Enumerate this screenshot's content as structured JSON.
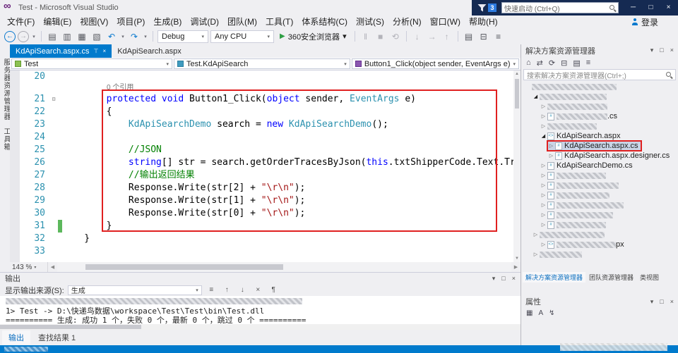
{
  "colors": {
    "accent": "#007ACC",
    "annotation_red": "#E02020",
    "keyword": "#0000FF",
    "type": "#2B91AF",
    "comment": "#008000",
    "string": "#A31515",
    "line_number": "#2B91AF",
    "title_overlay_bg": "#152A52"
  },
  "icons": {
    "vs_logo": "∞",
    "minimize": "─",
    "maximize": "□",
    "close": "×",
    "caret": "▾",
    "back": "←",
    "forward": "→",
    "new_file": "▤",
    "open_file": "▥",
    "save": "▦",
    "save_all": "▧",
    "undo": "↶",
    "redo": "↷",
    "play": "▶",
    "pause": "‖",
    "stop": "■",
    "restart": "⟲",
    "step_into": "↓",
    "step_over": "→",
    "step_out": "↑",
    "find": "▤",
    "pin": "⊤",
    "home": "⌂",
    "refresh": "⟳",
    "collapse_all": "⊟",
    "show_all_files": "▤",
    "properties": "≡",
    "sync": "⇄",
    "tree_collapsed": "▷",
    "tree_expanded": "◢",
    "fold_collapse": "⊟",
    "file_cs": "#",
    "file_aspx": "<>",
    "categorized": "▦",
    "alphabetical": "A",
    "events": "↯",
    "scroll_up": "▲",
    "scroll_down": "▼",
    "scroll_left": "◀",
    "scroll_right": "▶",
    "messages": "≡",
    "prev_message": "↑",
    "next_message": "↓",
    "clear_all": "×",
    "word_wrap": "¶"
  },
  "titlebar": {
    "title": "Test - Microsoft Visual Studio",
    "quick_launch": "快速启动 (Ctrl+Q)",
    "badge": "3"
  },
  "menubar": {
    "items": [
      "文件(F)",
      "编辑(E)",
      "视图(V)",
      "项目(P)",
      "生成(B)",
      "调试(D)",
      "团队(M)",
      "工具(T)",
      "体系结构(C)",
      "测试(S)",
      "分析(N)",
      "窗口(W)",
      "帮助(H)"
    ],
    "sign_in": "登录"
  },
  "toolbar": {
    "configuration": "Debug",
    "platform": "Any CPU",
    "run_target": "360安全浏览器"
  },
  "side_strip": {
    "tabs": [
      "服务器资源管理器",
      "工具箱"
    ]
  },
  "editor": {
    "tabs": [
      {
        "label": "KdApiSearch.aspx.cs",
        "active": true
      },
      {
        "label": "KdApiSearch.aspx",
        "active": false
      }
    ],
    "navbar": {
      "project": "Test",
      "type": "Test.KdApiSearch",
      "member": "Button1_Click(object sender, EventArgs e)"
    },
    "zoom": "143 %",
    "lines": [
      {
        "n": "20",
        "segs": []
      },
      {
        "n": "",
        "lens": true,
        "segs": [
          [
            "l",
            "0 个引用"
          ]
        ]
      },
      {
        "n": "21",
        "fold": true,
        "segs": [
          [
            "p",
            "        "
          ],
          [
            "k",
            "protected"
          ],
          [
            "p",
            " "
          ],
          [
            "k",
            "void"
          ],
          [
            "p",
            " Button1_Click("
          ],
          [
            "k",
            "object"
          ],
          [
            "p",
            " sender, "
          ],
          [
            "t",
            "EventArgs"
          ],
          [
            "p",
            " e)"
          ]
        ]
      },
      {
        "n": "22",
        "segs": [
          [
            "p",
            "        {"
          ]
        ]
      },
      {
        "n": "23",
        "segs": [
          [
            "p",
            "            "
          ],
          [
            "t",
            "KdApiSearchDemo"
          ],
          [
            "p",
            " search = "
          ],
          [
            "k",
            "new"
          ],
          [
            "p",
            " "
          ],
          [
            "t",
            "KdApiSearchDemo"
          ],
          [
            "p",
            "();"
          ]
        ]
      },
      {
        "n": "24",
        "segs": []
      },
      {
        "n": "25",
        "segs": [
          [
            "p",
            "            "
          ],
          [
            "c",
            "//JSON"
          ]
        ]
      },
      {
        "n": "26",
        "segs": [
          [
            "p",
            "            "
          ],
          [
            "k",
            "string"
          ],
          [
            "p",
            "[] str = search.getOrderTracesByJson("
          ],
          [
            "k",
            "this"
          ],
          [
            "p",
            ".txtShipperCode.Text.Trim(), t"
          ]
        ]
      },
      {
        "n": "27",
        "segs": [
          [
            "p",
            "            "
          ],
          [
            "c",
            "//输出返回结果"
          ]
        ]
      },
      {
        "n": "28",
        "segs": [
          [
            "p",
            "            Response.Write(str[2] + "
          ],
          [
            "s",
            "\"\\r\\n\""
          ],
          [
            "p",
            ");"
          ]
        ]
      },
      {
        "n": "29",
        "segs": [
          [
            "p",
            "            Response.Write(str[1] + "
          ],
          [
            "s",
            "\"\\r\\n\""
          ],
          [
            "p",
            ");"
          ]
        ]
      },
      {
        "n": "30",
        "segs": [
          [
            "p",
            "            Response.Write(str[0] + "
          ],
          [
            "s",
            "\"\\r\\n\""
          ],
          [
            "p",
            ");"
          ]
        ]
      },
      {
        "n": "31",
        "green": true,
        "segs": [
          [
            "p",
            "        }"
          ]
        ]
      },
      {
        "n": "32",
        "segs": [
          [
            "p",
            "    }"
          ]
        ]
      },
      {
        "n": "33",
        "segs": []
      }
    ]
  },
  "output": {
    "title": "输出",
    "source_label": "显示输出来源(S):",
    "source_value": "生成",
    "lines": [
      {
        "parts": [
          {
            "cw": 420
          }
        ]
      },
      {
        "parts": [
          {
            "t": "1>  Test -> D:\\快递鸟数据\\workspace\\Test\\Test\\bin\\Test.dll"
          }
        ]
      },
      {
        "parts": [
          {
            "t": "========== 生成: 成功 1 个，失败 0 个，最新 0 个，跳过 0 个 =========="
          }
        ]
      }
    ]
  },
  "bottom_tabs": [
    {
      "label": "输出",
      "active": true
    },
    {
      "label": "查找结果 1",
      "active": false
    }
  ],
  "solution_explorer": {
    "title": "解决方案资源管理器",
    "search_placeholder": "搜索解决方案资源管理器(Ctrl+;)",
    "items": [
      {
        "cw": 120,
        "indent": 0
      },
      {
        "cw": 95,
        "indent": 1,
        "arrow": "expanded"
      },
      {
        "cw": 85,
        "indent": 2,
        "arrow": "collapsed"
      },
      {
        "cw": 72,
        "indent": 2,
        "arrow": "collapsed",
        "suffix": ".cs",
        "icon": "cs"
      },
      {
        "cw": 70,
        "indent": 2,
        "arrow": "collapsed"
      },
      {
        "label": "KdApiSearch.aspx",
        "indent": 2,
        "arrow": "expanded",
        "icon": "aspx"
      },
      {
        "label": "KdApiSearch.aspx.cs",
        "indent": 3,
        "arrow": "collapsed",
        "icon": "cs",
        "selected": true,
        "annotated": true
      },
      {
        "label": "KdApiSearch.aspx.designer.cs",
        "indent": 3,
        "arrow": "collapsed",
        "icon": "cs"
      },
      {
        "label": "KdApiSearchDemo.cs",
        "indent": 2,
        "arrow": "collapsed",
        "icon": "cs"
      },
      {
        "cw": 70,
        "indent": 2,
        "arrow": "collapsed",
        "icon": "cs"
      },
      {
        "cw": 88,
        "indent": 2,
        "arrow": "collapsed",
        "icon": "cs"
      },
      {
        "cw": 75,
        "indent": 2,
        "arrow": "collapsed",
        "icon": "cs"
      },
      {
        "cw": 95,
        "indent": 2,
        "arrow": "collapsed",
        "icon": "cs"
      },
      {
        "cw": 80,
        "indent": 2,
        "arrow": "collapsed",
        "icon": "cs"
      },
      {
        "cw": 70,
        "indent": 2,
        "arrow": "collapsed",
        "icon": "cs"
      },
      {
        "cw": 92,
        "indent": 1,
        "arrow": "collapsed"
      },
      {
        "cw": 84,
        "indent": 2,
        "arrow": "collapsed",
        "suffix": "px",
        "icon": "aspx"
      },
      {
        "cw": 60,
        "indent": 1,
        "arrow": "collapsed"
      }
    ],
    "bottom_tabs": [
      {
        "label": "解决方案资源管理器",
        "active": true
      },
      {
        "label": "团队资源管理器",
        "active": false
      },
      {
        "label": "类视图",
        "active": false
      }
    ]
  },
  "properties_panel": {
    "title": "属性"
  }
}
